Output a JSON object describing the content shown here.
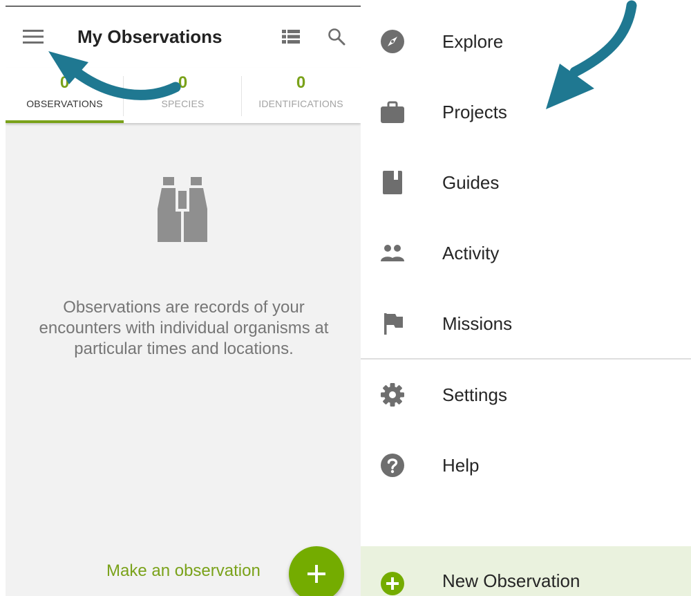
{
  "app_bar": {
    "title": "My Observations"
  },
  "tabs": [
    {
      "count": "0",
      "label": "OBSERVATIONS",
      "active": true
    },
    {
      "count": "0",
      "label": "SPECIES",
      "active": false
    },
    {
      "count": "0",
      "label": "IDENTIFICATIONS",
      "active": false
    }
  ],
  "empty_state": {
    "icon": "binoculars-icon",
    "message": "Observations are records of your encounters with individual organisms at particular times and locations."
  },
  "make_observation_link": "Make an observation",
  "fab_icon": "plus-icon",
  "drawer": {
    "items": [
      {
        "label": "Explore",
        "icon": "compass-icon"
      },
      {
        "label": "Projects",
        "icon": "briefcase-icon"
      },
      {
        "label": "Guides",
        "icon": "book-icon"
      },
      {
        "label": "Activity",
        "icon": "people-icon"
      },
      {
        "label": "Missions",
        "icon": "flag-icon"
      },
      {
        "label": "Settings",
        "icon": "gear-icon"
      },
      {
        "label": "Help",
        "icon": "help-icon"
      }
    ],
    "new_observation": {
      "label": "New Observation",
      "icon": "add-circle-icon"
    }
  },
  "colors": {
    "accent_green": "#7aa21a",
    "fab_green": "#74ac00",
    "arrow_teal": "#1f7891",
    "icon_grey": "#6e6e6e"
  }
}
